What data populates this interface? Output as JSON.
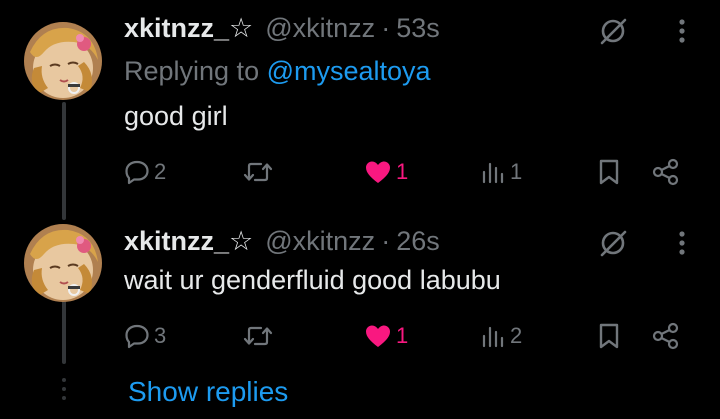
{
  "colors": {
    "background": "#000000",
    "primary_text": "#e7e9ea",
    "secondary_text": "#71767b",
    "accent_blue": "#1d9bf0",
    "like_pink": "#f91880",
    "thread_line": "#333639"
  },
  "replies": [
    {
      "display_name": "xkitnzz_☆",
      "handle": "@xkitnzz",
      "separator": "·",
      "time": "53s",
      "replying_prefix": "Replying to",
      "replying_to": "@mysealtoya",
      "text": "good girl",
      "actions": {
        "reply_count": "2",
        "repost_count": "",
        "like_count": "1",
        "view_count": "1"
      },
      "icons": [
        "grok-icon",
        "more-icon",
        "reply-icon",
        "repost-icon",
        "like-icon-filled",
        "views-icon",
        "bookmark-icon",
        "share-icon"
      ]
    },
    {
      "display_name": "xkitnzz_☆",
      "handle": "@xkitnzz",
      "separator": "·",
      "time": "26s",
      "text": "wait ur genderfluid good labubu",
      "actions": {
        "reply_count": "3",
        "repost_count": "",
        "like_count": "1",
        "view_count": "2"
      },
      "icons": [
        "grok-icon",
        "more-icon",
        "reply-icon",
        "repost-icon",
        "like-icon-filled",
        "views-icon",
        "bookmark-icon",
        "share-icon"
      ]
    }
  ],
  "show_replies_label": "Show replies"
}
